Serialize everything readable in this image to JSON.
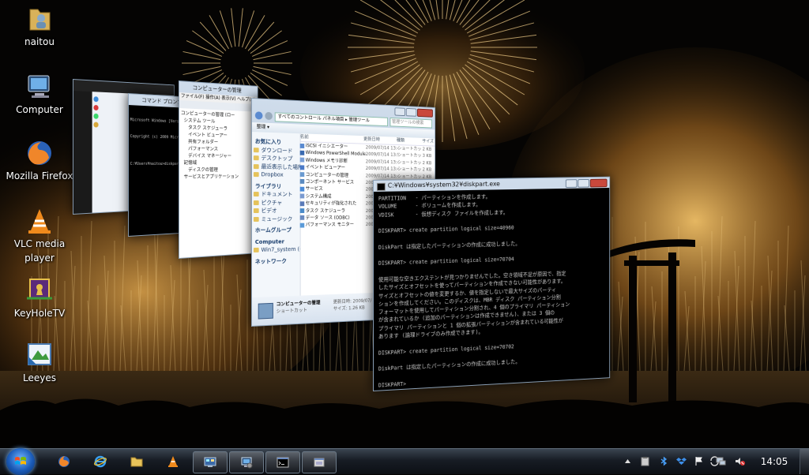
{
  "desktop": {
    "icons": [
      {
        "label": "naitou"
      },
      {
        "label": "Computer"
      },
      {
        "label": "Mozilla Firefox"
      },
      {
        "label": "VLC media player"
      },
      {
        "label": "KeyHoleTV"
      },
      {
        "label": "Leeyes"
      }
    ]
  },
  "windows": {
    "control_panel": {
      "title": "コンピューターの管理",
      "nav_items": [
        "コンピューターの管理 (ロー",
        "システム ツール",
        "タスク スケジューラ",
        "イベント ビューアー",
        "共有フォルダー",
        "パフォーマンス",
        "デバイス マネージャー",
        "記憶域",
        "ディスクの管理",
        "サービスとアプリケーション"
      ],
      "menu": [
        "ファイル(F)",
        "操作(A)",
        "表示(V)",
        "ヘルプ(H)"
      ]
    },
    "cmd_back": {
      "title": "コマンド プロンプト - diskpart",
      "lines": [
        "Microsoft Windows [Version",
        "Copyright (c) 2009 Micr",
        "",
        "C:¥Users¥naitou>diskpart"
      ]
    },
    "admin_tools": {
      "address": "すべてのコントロール パネル項目 ▸ 管理ツール",
      "search_placeholder": "管理ツールの検索",
      "toolbar_label": "整理 ▾",
      "columns": [
        "名前",
        "更新日時",
        "種類",
        "サイズ"
      ],
      "nav": {
        "favorites": "お気に入り",
        "fav_items": [
          "ダウンロード",
          "デスクトップ",
          "最近表示した場所",
          "Dropbox"
        ],
        "libraries": "ライブラリ",
        "lib_items": [
          "ドキュメント",
          "ピクチャ",
          "ビデオ",
          "ミュージック"
        ],
        "homegroup": "ホームグループ",
        "computer": "Computer",
        "computer_items": [
          "Win7_system (C"
        ],
        "network": "ネットワーク"
      },
      "files": [
        {
          "name": "iSCSI イニシエーター",
          "date": "2009/07/14 13:41",
          "type": "ショートカット",
          "size": "2 KB"
        },
        {
          "name": "Windows PowerShell Modules",
          "date": "2009/07/14 13:52",
          "type": "ショートカット",
          "size": "3 KB"
        },
        {
          "name": "Windows メモリ診断",
          "date": "2009/07/14 13:41",
          "type": "ショートカット",
          "size": "2 KB"
        },
        {
          "name": "イベント ビューアー",
          "date": "2009/07/14 13:42",
          "type": "ショートカット",
          "size": "2 KB"
        },
        {
          "name": "コンピューターの管理",
          "date": "2009/07/14 13:41",
          "type": "ショートカット",
          "size": "2 KB"
        },
        {
          "name": "コンポーネント サービス",
          "date": "2009/07/14 13:46",
          "type": "ショートカット",
          "size": "2 KB"
        },
        {
          "name": "サービス",
          "date": "2009/07/14 13:41",
          "type": "ショートカット",
          "size": "2 KB"
        },
        {
          "name": "システム構成",
          "date": "2009/07/14 13:41",
          "type": "ショートカット",
          "size": "2 KB"
        },
        {
          "name": "セキュリティが強化された",
          "date": "2009/07/14 13:41",
          "type": "ショートカット",
          "size": "2 KB"
        },
        {
          "name": "タスク スケジューラ",
          "date": "2009/07/14 13:42",
          "type": "ショートカット",
          "size": "2 KB"
        },
        {
          "name": "データ ソース (ODBC)",
          "date": "2009/07/14 13:41",
          "type": "ショートカット",
          "size": "2 KB"
        },
        {
          "name": "パフォーマンス モニター",
          "date": "2009/07/14 13:41",
          "type": "ショートカット",
          "size": "2 KB"
        }
      ],
      "details": {
        "name": "コンピューターの管理",
        "type": "ショートカット",
        "modified_label": "更新日時: 2009/07/",
        "size_label": "サイズ: 1.26 KB"
      }
    },
    "cmd_front": {
      "title": "C:¥Windows¥system32¥diskpart.exe",
      "lines": [
        "PARTITION   - パーティションを作成します。",
        "VOLUME      - ボリュームを作成します。",
        "VDISK       - 仮想ディスク ファイルを作成します。",
        "",
        "DISKPART> create partition logical size=40960",
        "",
        "DiskPart は指定したパーティションの作成に成功しました。",
        "",
        "DISKPART> create partition logical size=70704",
        "",
        "使用可能な空きエクステントが見つかりませんでした。空き領域不足が原因で、指定",
        "したサイズとオフセットを使ってパーティションを作成できない可能性があります。",
        "サイズとオフセットの値を変更するか、値を指定しないで最大サイズのパーティ",
        "ションを作成してください。このディスクは、MBR ディスク パーティション分割",
        "フォーマットを使用してパーティション分割され、4 個のプライマリ パーティション",
        "が含まれているか (追加のパーティションは作成できません)、または 3 個の",
        "プライマリ パーティションと 1 個の拡張パーティションが含まれている可能性が",
        "あります (論理ドライブのみ作成できます)。",
        "",
        "DISKPART> create partition logical size=70702",
        "",
        "DiskPart は指定したパーティションの作成に成功しました。",
        "",
        "DISKPART>"
      ]
    }
  },
  "taskbar": {
    "clock": "14:05"
  }
}
